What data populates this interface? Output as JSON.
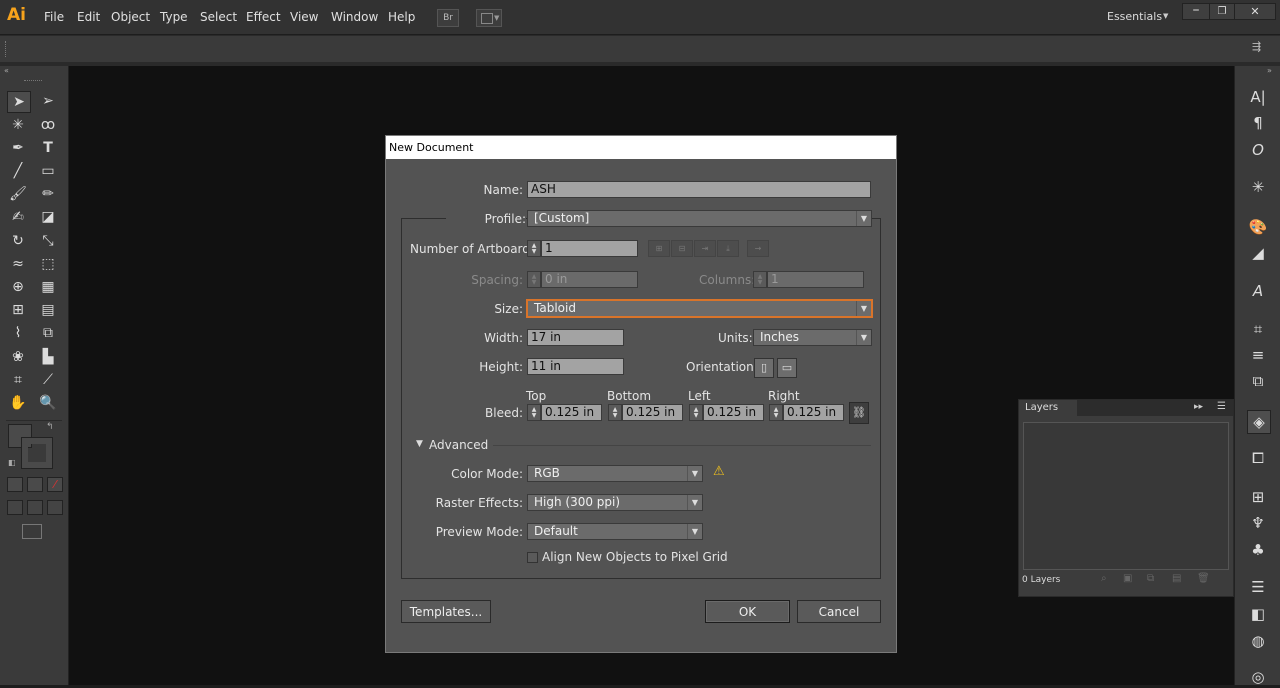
{
  "app": {
    "logo": "Ai",
    "menus": [
      "File",
      "Edit",
      "Object",
      "Type",
      "Select",
      "Effect",
      "View",
      "Window",
      "Help"
    ],
    "bridge_label": "Br",
    "workspace": "Essentials"
  },
  "dialog": {
    "title": "New Document",
    "name_label": "Name:",
    "name_value": "ASH",
    "profile_label": "Profile:",
    "profile_value": "[Custom]",
    "artboards_label": "Number of Artboards:",
    "artboards_value": "1",
    "spacing_label": "Spacing:",
    "spacing_value": "0 in",
    "columns_label": "Columns:",
    "columns_value": "1",
    "size_label": "Size:",
    "size_value": "Tabloid",
    "width_label": "Width:",
    "width_value": "17 in",
    "units_label": "Units:",
    "units_value": "Inches",
    "height_label": "Height:",
    "height_value": "11 in",
    "orientation_label": "Orientation:",
    "bleed_label": "Bleed:",
    "bleed": [
      {
        "label": "Top",
        "value": "0.125 in"
      },
      {
        "label": "Bottom",
        "value": "0.125 in"
      },
      {
        "label": "Left",
        "value": "0.125 in"
      },
      {
        "label": "Right",
        "value": "0.125 in"
      }
    ],
    "advanced_label": "Advanced",
    "color_mode_label": "Color Mode:",
    "color_mode_value": "RGB",
    "raster_label": "Raster Effects:",
    "raster_value": "High (300 ppi)",
    "preview_label": "Preview Mode:",
    "preview_value": "Default",
    "align_label": "Align New Objects to Pixel Grid",
    "templates_button": "Templates...",
    "ok_button": "OK",
    "cancel_button": "Cancel"
  },
  "layers": {
    "tab": "Layers",
    "count": "0 Layers"
  },
  "colors": {
    "accent": "#f7a31c",
    "size_focus": "#d9742a",
    "warning": "#f2c21b"
  }
}
